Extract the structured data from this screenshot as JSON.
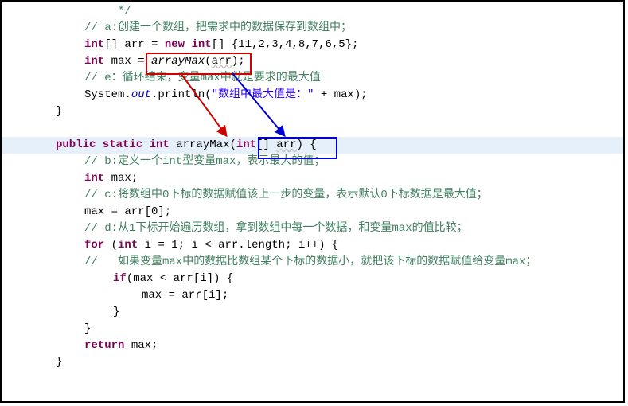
{
  "code": {
    "l1": "     */",
    "l2_a": "// a:创建一个数组，把需求中的数据保存到数组中；",
    "l3_kw1": "int",
    "l3_txt1": "[] arr = ",
    "l3_kw2": "new int",
    "l3_txt2": "[] {11,2,3,4,8,7,6,5};",
    "l4_kw": "int",
    "l4_txt1": " max = ",
    "l4_method": "arrayMax",
    "l4_txt2": "(",
    "l4_arg": "arr",
    "l4_txt3": ");",
    "l5": "// e：循环结束，变量max中就是要求的最大值",
    "l6_a": "System.",
    "l6_out": "out",
    "l6_b": ".println(",
    "l6_str": "\"数组中最大值是：\"",
    "l6_c": " + max);",
    "l7": "}",
    "l8_blank": " ",
    "l9_kw": "public static int",
    "l9_name": " arrayMax(",
    "l9_param_kw": "int",
    "l9_param_txt": "[] ",
    "l9_param_name": "arr",
    "l9_end": ") {",
    "l10": "// b:定义一个int型变量max，表示最大的值；",
    "l11_kw": "int",
    "l11_txt": " max;",
    "l12": "// c:将数组中0下标的数据赋值该上一步的变量，表示默认0下标数据是最大值；",
    "l13": "max = arr[0];",
    "l14": "// d:从1下标开始遍历数组，拿到数组中每一个数据，和变量max的值比较；",
    "l15_kw1": "for",
    "l15_txt1": " (",
    "l15_kw2": "int",
    "l15_txt2": " i = 1; i < arr.length; i++) {",
    "l16": "//   如果变量max中的数据比数组某个下标的数据小，就把该下标的数据赋值给变量max；",
    "l17_kw": "if",
    "l17_txt": "(max < arr[i]) {",
    "l18": "max = arr[i];",
    "l19": "}",
    "l20": "}",
    "l21_kw": "return",
    "l21_txt": " max;",
    "l22": "}"
  }
}
